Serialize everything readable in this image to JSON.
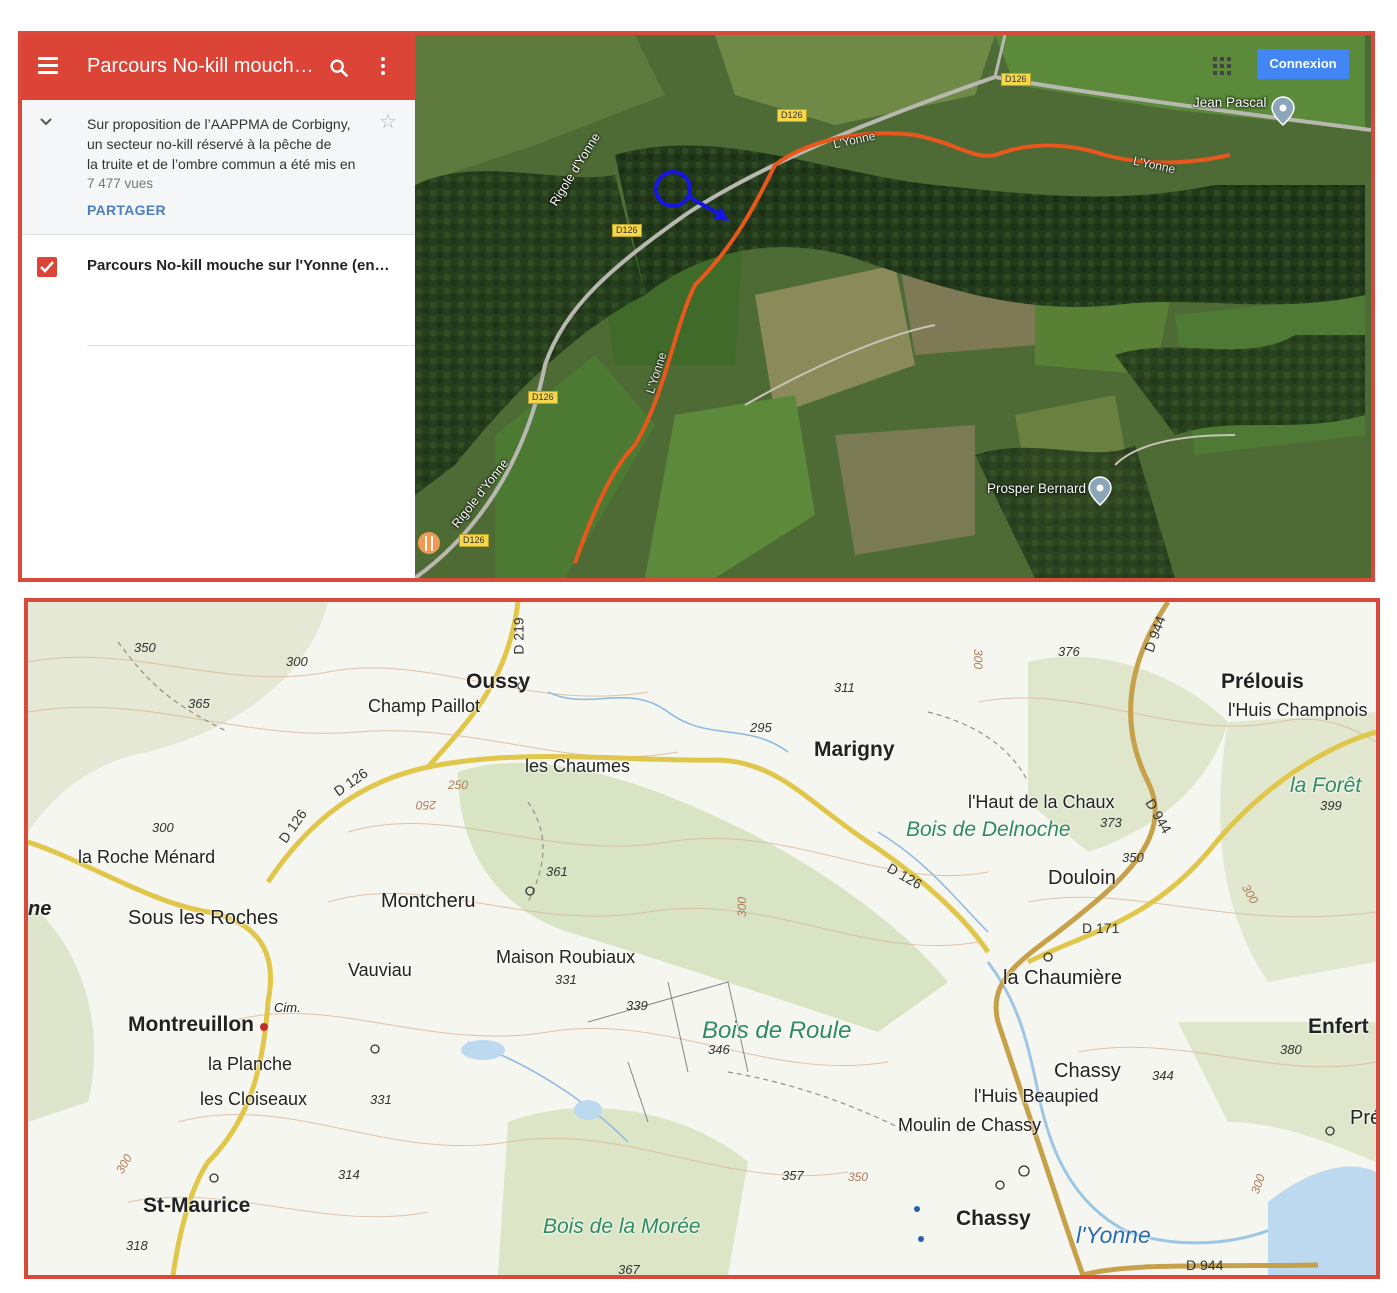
{
  "top_panel": {
    "app_bar": {
      "title": "Parcours No-kill mouch…",
      "icons": [
        "menu-icon",
        "search-icon",
        "more-vert-icon"
      ],
      "color": "#db4437"
    },
    "description": {
      "lines": [
        "Sur proposition de l’AAPPMA de Corbigny,",
        "un secteur no-kill réservé à la pêche de",
        "la truite et de l’ombre commun a été mis en"
      ],
      "views": "7 477 vues",
      "share_label": "PARTAGER"
    },
    "layer": {
      "title": "Parcours No-kill mouche sur l'Yonne (en…",
      "checked": true
    },
    "satellite_map": {
      "connexion_label": "Connexion",
      "labels": {
        "jean_pascal": "Jean Pascal",
        "prosper_bernard": "Prosper Bernard",
        "rigole1": "Rigole d'Yonne",
        "rigole2": "Rigole d'Yonne",
        "yonne1": "L'Yonne",
        "yonne2": "L'Yonne",
        "yonne3": "L'Yonne"
      },
      "road_tags": [
        "D126",
        "D126",
        "D126",
        "D126",
        "D126"
      ],
      "route_color": "#e8581c",
      "marker_color": "#1616e0"
    }
  },
  "bottom_panel": {
    "places": {
      "oussy": "Oussy",
      "champ_paillot": "Champ Paillot",
      "les_chaumes": "les Chaumes",
      "marigny": "Marigny",
      "prelouis": "Prélouis",
      "huis_champnois": "l'Huis Champnois",
      "la_foret": "la Forêt",
      "haut_de_la_chaux": "l'Haut de la Chaux",
      "bois_de_delnoche": "Bois de Delnoche",
      "douloin": "Douloin",
      "la_roche_menard": "la Roche Ménard",
      "sous_les_roches": "Sous les Roches",
      "montcheru": "Montcheru",
      "maison_roubiaux": "Maison Roubiaux",
      "vauviau": "Vauviau",
      "la_chaumiere": "la Chaumière",
      "montreuillon": "Montreuillon",
      "cim": "Cim.",
      "bois_de_roule": "Bois de Roule",
      "enfert": "Enfert",
      "la_planche": "la Planche",
      "les_cloiseaux": "les Cloiseaux",
      "chassy_upper": "Chassy",
      "huis_beaupied": "l'Huis Beaupied",
      "moulin_de_chassy": "Moulin de Chassy",
      "pre": "Pré",
      "st_maurice": "St-Maurice",
      "bois_de_la_moree": "Bois de la Morée",
      "chassy": "Chassy",
      "yonne": "l'Yonne",
      "ne": "ne"
    },
    "altitudes": [
      "350",
      "365",
      "300",
      "376",
      "311",
      "295",
      "373",
      "399",
      "300",
      "361",
      "350",
      "331",
      "339",
      "346",
      "380",
      "344",
      "331",
      "314",
      "357",
      "318",
      "367",
      "300",
      "250",
      "350",
      "300",
      "300",
      "300"
    ],
    "road_labels": {
      "d219": "D 219",
      "d126_a": "D 126",
      "d126_b": "D 126",
      "d126_c": "D 126",
      "d944_a": "D 944",
      "d944_b": "D 944",
      "d944_c": "D 944",
      "d171": "D 171"
    },
    "contour_labels": [
      "250",
      "250",
      "300",
      "300",
      "300",
      "300",
      "300",
      "350"
    ]
  }
}
